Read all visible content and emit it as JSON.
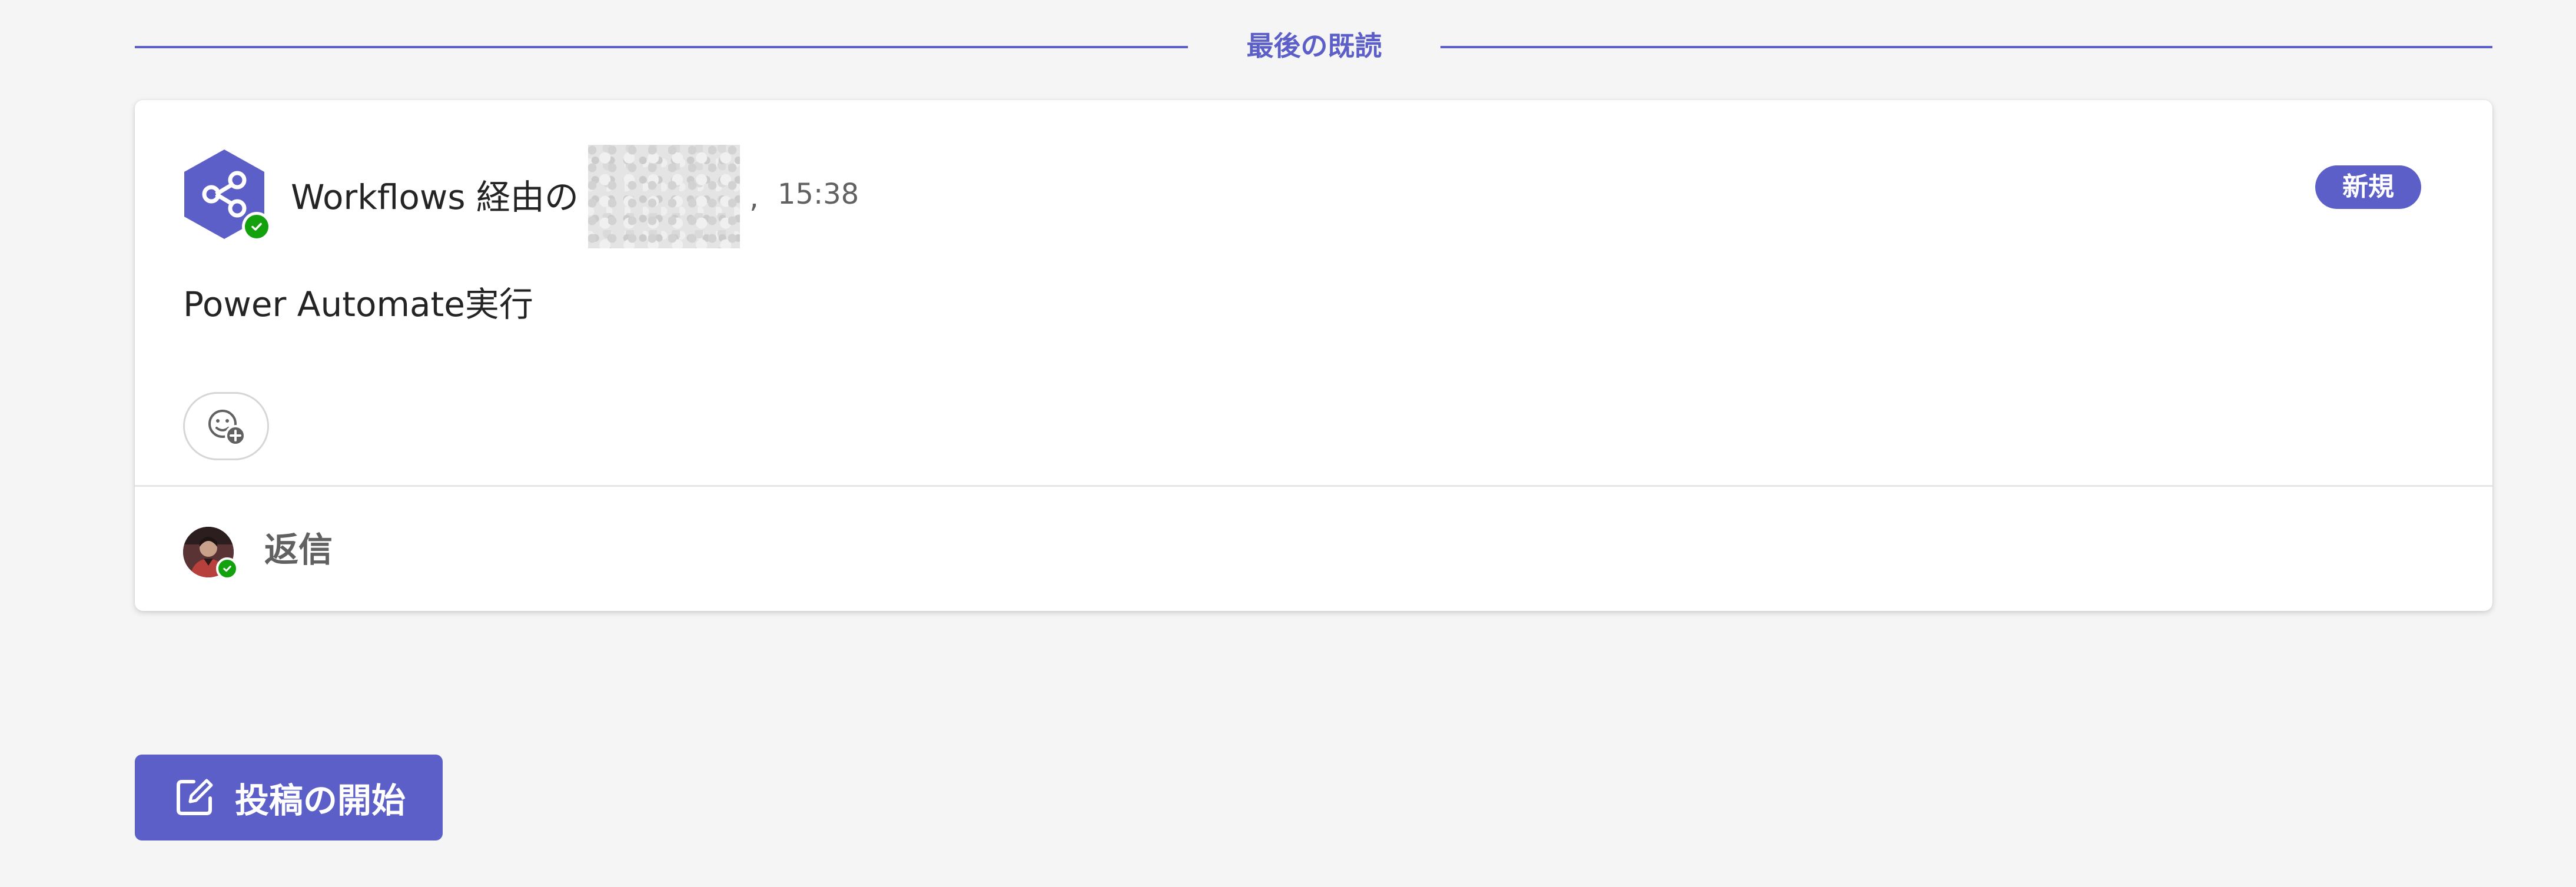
{
  "divider": {
    "label": "最後の既読"
  },
  "post": {
    "sender_text": "Workflows 経由の",
    "separator": ",",
    "timestamp": "15:38",
    "badge": "新規",
    "body": "Power Automate実行",
    "sender_icon": "workflows-share-icon",
    "reaction_icon": "add-reaction-icon"
  },
  "reply": {
    "label": "返信"
  },
  "actions": {
    "start_post_label": "投稿の開始",
    "start_post_icon": "compose-icon"
  },
  "colors": {
    "accent": "#5b5fc7",
    "status_available": "#13a10e",
    "background": "#f5f5f5",
    "card": "#ffffff",
    "text_primary": "#242424",
    "text_secondary": "#616161"
  }
}
